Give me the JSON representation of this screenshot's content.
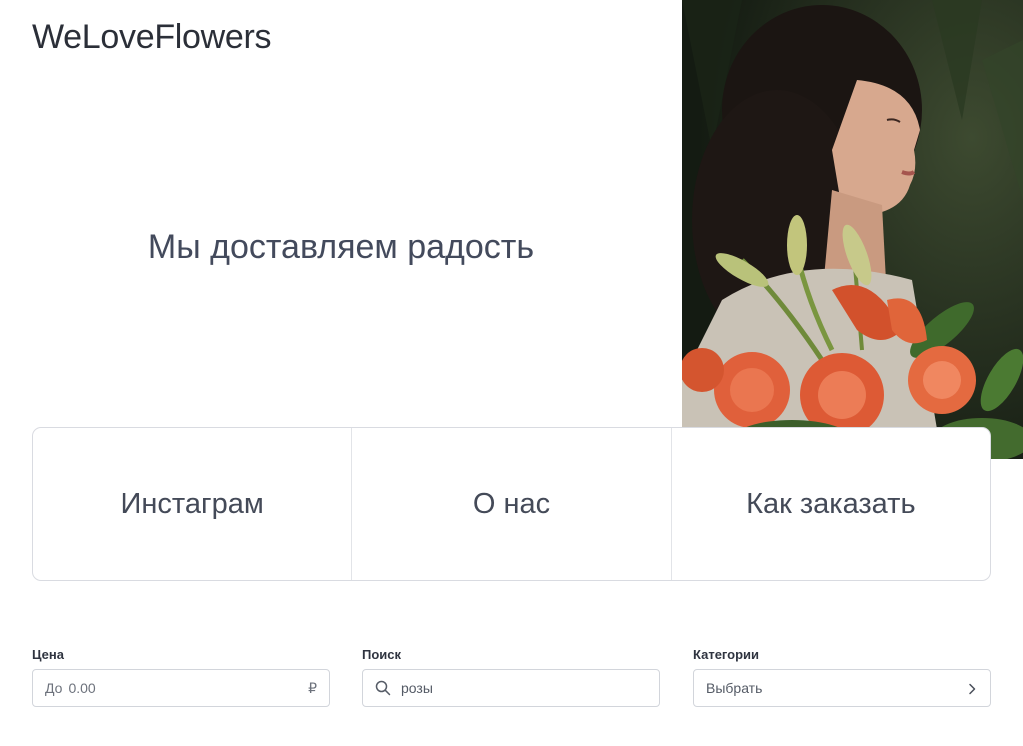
{
  "header": {
    "brand": "WeLoveFlowers"
  },
  "hero": {
    "tagline": "Мы доставляем радость"
  },
  "nav": {
    "items": [
      {
        "label": "Инстаграм"
      },
      {
        "label": "О нас"
      },
      {
        "label": "Как заказать"
      }
    ]
  },
  "filters": {
    "price": {
      "label": "Цена",
      "prefix": "До",
      "placeholder": "0.00",
      "currency": "₽"
    },
    "search": {
      "label": "Поиск",
      "value": "розы",
      "icon": "search-icon"
    },
    "category": {
      "label": "Категории",
      "value": "Выбрать",
      "icon": "chevron-right-icon"
    }
  }
}
